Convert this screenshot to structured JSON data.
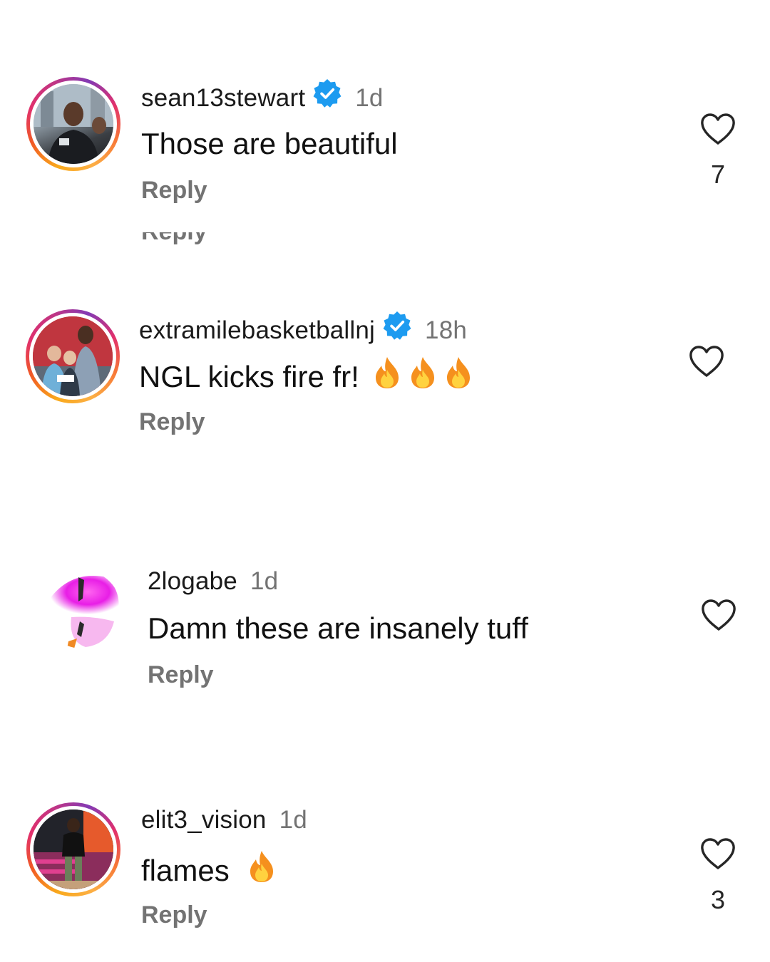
{
  "comments": [
    {
      "username": "sean13stewart",
      "verified": true,
      "time": "1d",
      "text": "Those are beautiful",
      "reply_label": "Reply",
      "likes": "7",
      "has_story_ring": true,
      "avatar_icon": "person-photo"
    },
    {
      "username": "extramilebasketballnj",
      "verified": true,
      "time": "18h",
      "text": "NGL kicks fire fr!",
      "emojis": "fire-icon x3",
      "reply_label": "Reply",
      "likes": "",
      "has_story_ring": true,
      "avatar_icon": "group-photo"
    },
    {
      "username": "2logabe",
      "verified": false,
      "time": "1d",
      "text": "Damn these are insanely tuff",
      "reply_label": "Reply",
      "likes": "",
      "has_story_ring": false,
      "avatar_icon": "abstract-photo"
    },
    {
      "username": "elit3_vision",
      "verified": false,
      "time": "1d",
      "text": "flames",
      "emojis": "fire-icon x1",
      "reply_label": "Reply",
      "likes": "3",
      "has_story_ring": true,
      "avatar_icon": "court-photo"
    }
  ],
  "partial_reply_label": "Reply",
  "colors": {
    "verified_blue": "#1d9bf0",
    "secondary_text": "#737373",
    "primary_text": "#111111"
  }
}
